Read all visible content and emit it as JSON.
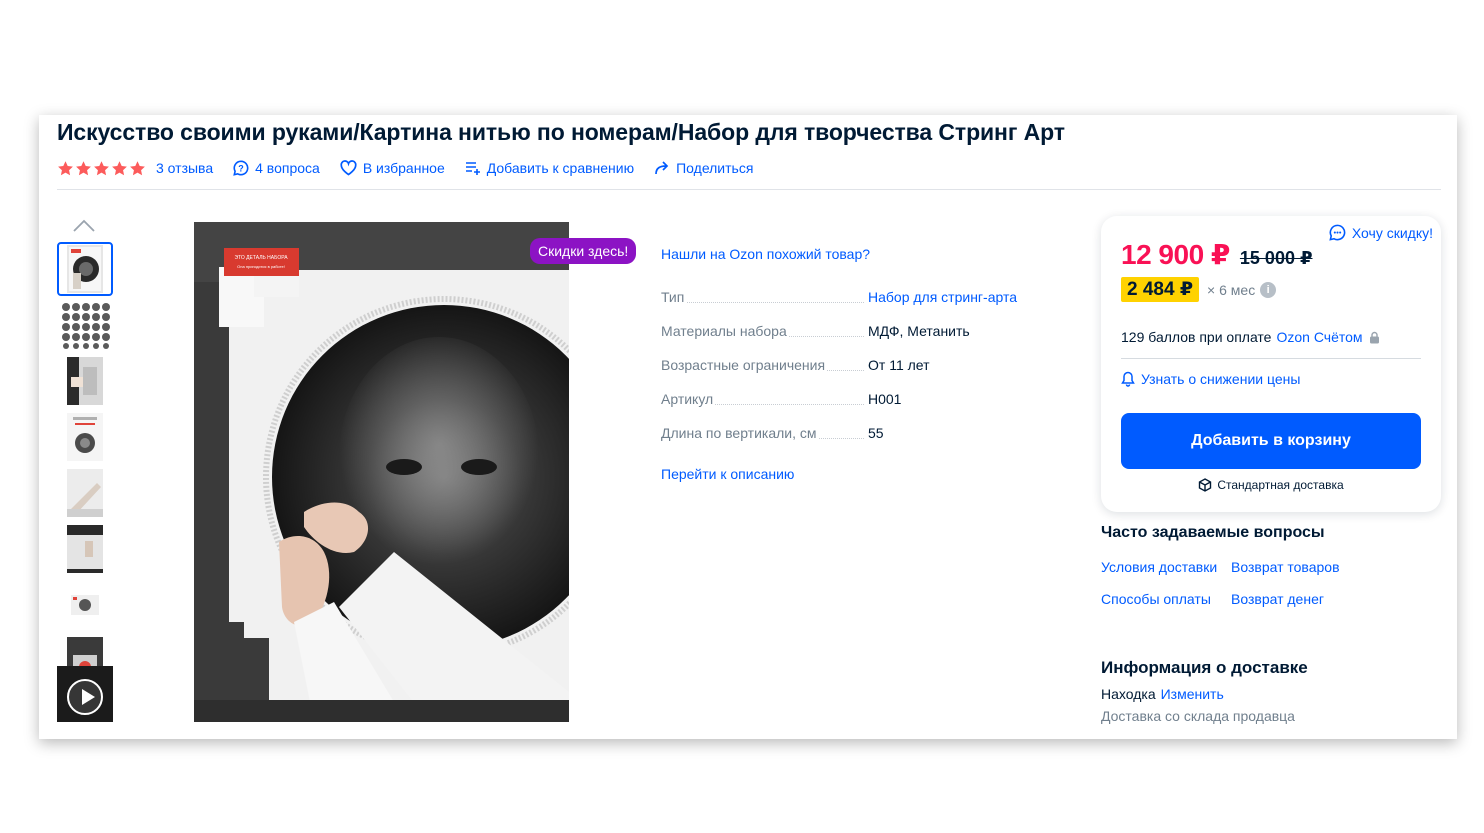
{
  "product": {
    "title": "Искусство своими руками/Картина нитью по номерам/Набор для творчества Стринг Арт",
    "rating_stars": 5,
    "reviews": "3 отзыва",
    "questions": "4 вопроса",
    "favorite": "В избранное",
    "compare": "Добавить к сравнению",
    "share": "Поделиться"
  },
  "gallery": {
    "thumbnail_count": 8,
    "has_video": true,
    "badge": "Скидки здесь!",
    "image_text": [
      "ЭТО ДЕТАЛЬ НАБОРА",
      "Она пригодится в работе!"
    ]
  },
  "characteristics": {
    "similar_link": "Нашли на Ozon похожий товар?",
    "rows": [
      {
        "key": "Тип",
        "value": "Набор для стринг-арта"
      },
      {
        "key": "Материалы набора",
        "value": "МДФ, Метанить"
      },
      {
        "key": "Возрастные ограничения",
        "value": "От 11 лет"
      },
      {
        "key": "Артикул",
        "value": "Н001"
      },
      {
        "key": "Длина по вертикали, см",
        "value": "55"
      }
    ],
    "goto_description": "Перейти к описанию"
  },
  "buybox": {
    "want_discount": "Хочу скидку!",
    "price": "12 900 ₽",
    "old_price": "15 000 ₽",
    "installment": "2 484 ₽",
    "installment_term": "× 6 мес",
    "points": "129 баллов при оплате",
    "points_link": "Ozon Счётом",
    "notify": "Узнать о снижении цены",
    "add_to_cart": "Добавить в корзину",
    "delivery": "Стандартная доставка"
  },
  "faq": {
    "title": "Часто задаваемые вопросы",
    "links": [
      "Условия доставки",
      "Возврат товаров",
      "Способы оплаты",
      "Возврат денег"
    ]
  },
  "delivery_info": {
    "title": "Информация о доставке",
    "location_label": "Находка",
    "change_link": "Изменить",
    "note": "Доставка со склада продавца"
  },
  "colors": {
    "brand_blue": "#005bff",
    "price_red": "#f91155",
    "star": "#fc5b5b",
    "installment_yellow": "#ffd200",
    "badge_purple": "#8c13c4"
  }
}
